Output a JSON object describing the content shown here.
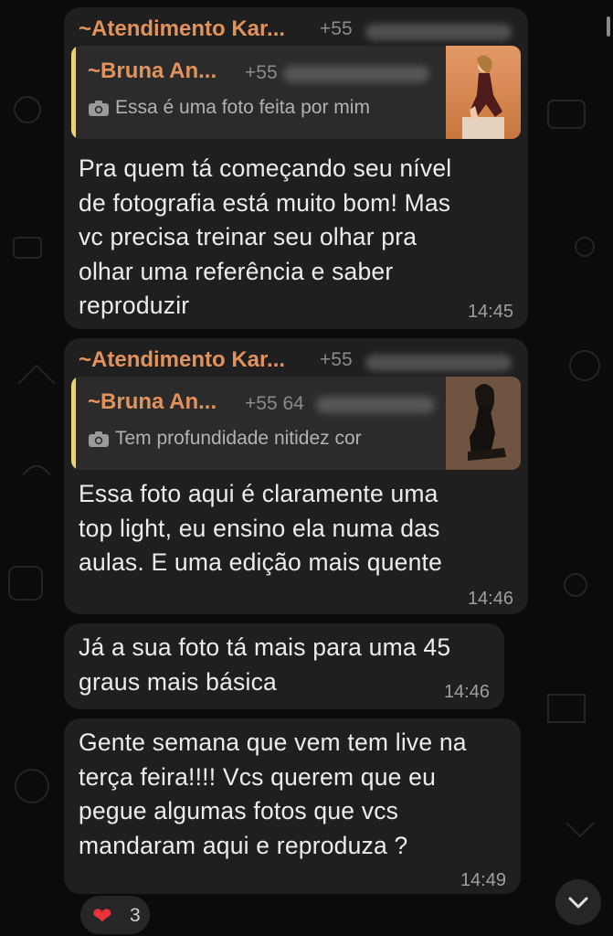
{
  "colors": {
    "sender": "#e2925c",
    "quote_bar": "#ebd17b",
    "bubble": "#1f1f1f",
    "background": "#0b0b0b",
    "heart": "#e8323c"
  },
  "messages": [
    {
      "sender": "~Atendimento Kar...",
      "sender_phone": "+55",
      "quote": {
        "sender": "~Bruna An...",
        "phone": "+55",
        "icon": "camera-icon",
        "text": "Essa é uma foto feita por mim"
      },
      "text": "Pra quem tá começando seu nível\nde fotografia está muito bom! Mas\nvc precisa treinar seu olhar pra\nolhar uma referência e saber\nreproduzir",
      "time": "14:45"
    },
    {
      "sender": "~Atendimento Kar...",
      "sender_phone": "+55",
      "quote": {
        "sender": "~Bruna An...",
        "phone": "+55 64",
        "icon": "camera-icon",
        "text": "Tem profundidade nitidez cor"
      },
      "text": "Essa foto aqui é claramente uma\ntop light, eu ensino ela numa das\naulas. E uma edição mais quente",
      "time": "14:46"
    },
    {
      "text": "Já a sua foto tá mais para uma 45\ngraus mais básica",
      "time": "14:46"
    },
    {
      "text": "Gente semana que vem tem live na\nterça feira!!!! Vcs querem que eu\npegue algumas fotos que vcs\nmandaram aqui e reproduza ?",
      "time": "14:49"
    }
  ],
  "reaction": {
    "icon": "heart-icon",
    "count": "3"
  },
  "scroll_button_icon": "chevron-down-icon"
}
